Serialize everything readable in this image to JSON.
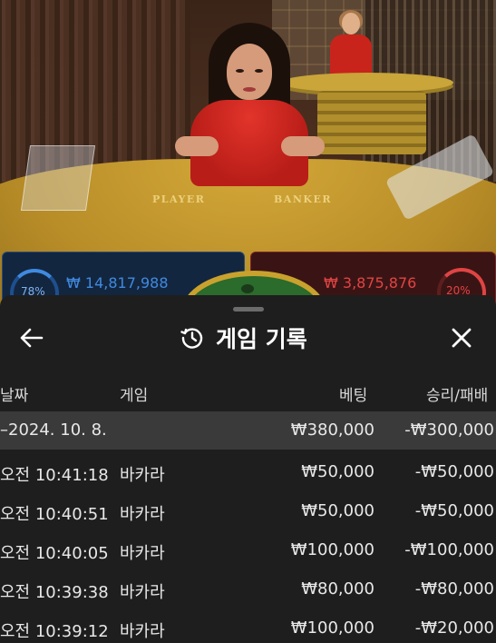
{
  "scene": {
    "felt_player": "PLAYER",
    "felt_banker": "BANKER"
  },
  "bets": {
    "player_pct": "78%",
    "player_amount": "₩ 14,817,988",
    "banker_pct": "20%",
    "banker_amount": "₩ 3,875,876"
  },
  "history": {
    "title": "게임 기록",
    "columns": {
      "date": "날짜",
      "game": "게임",
      "bet": "베팅",
      "winloss": "승리/패배"
    },
    "summary": {
      "date": "–2024. 10. 8.",
      "bet": "₩380,000",
      "winloss": "-₩300,000"
    },
    "rows": [
      {
        "time": "오전 10:41:18",
        "game": "바카라",
        "bet": "₩50,000",
        "winloss": "-₩50,000"
      },
      {
        "time": "오전 10:40:51",
        "game": "바카라",
        "bet": "₩50,000",
        "winloss": "-₩50,000"
      },
      {
        "time": "오전 10:40:05",
        "game": "바카라",
        "bet": "₩100,000",
        "winloss": "-₩100,000"
      },
      {
        "time": "오전 10:39:38",
        "game": "바카라",
        "bet": "₩80,000",
        "winloss": "-₩80,000"
      },
      {
        "time": "오전 10:39:12",
        "game": "바카라",
        "bet": "₩100,000",
        "winloss": "-₩20,000"
      }
    ]
  },
  "icons": {
    "back": "arrow-left-icon",
    "history": "history-clock-icon",
    "close": "close-icon"
  },
  "colors": {
    "sheet_bg": "#1e1e1e",
    "summary_row_bg": "#3a3a3a",
    "player_blue": "#3f8ae0",
    "banker_red": "#e04444"
  }
}
